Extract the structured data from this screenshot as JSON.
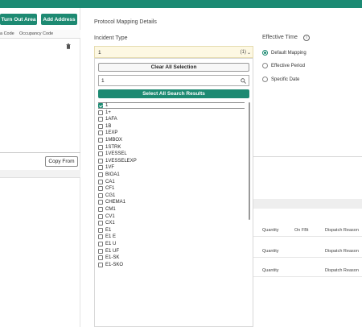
{
  "header": {
    "buttons": {
      "turn_out_area": "Turn Out Area",
      "add_address": "Add Address"
    },
    "left_columns": [
      "a Code",
      "Occupancy Code"
    ],
    "copy_from": "Copy From"
  },
  "protocol_mapping": {
    "title": "Protocol Mapping Details",
    "incident_type_label": "Incident Type",
    "selected_value": "1",
    "selected_count": "(1)",
    "clear_all": "Clear All Selection",
    "search_value": "1",
    "select_all": "Select All Search Results",
    "options": [
      {
        "label": "1",
        "checked": true
      },
      {
        "label": "1+",
        "checked": false
      },
      {
        "label": "1AFA",
        "checked": false
      },
      {
        "label": "1B",
        "checked": false
      },
      {
        "label": "1EXP",
        "checked": false
      },
      {
        "label": "1MBOX",
        "checked": false
      },
      {
        "label": "1STRK",
        "checked": false
      },
      {
        "label": "1VESSEL",
        "checked": false
      },
      {
        "label": "1VESSELEXP",
        "checked": false
      },
      {
        "label": "1VF",
        "checked": false
      },
      {
        "label": "BIOA1",
        "checked": false
      },
      {
        "label": "CA1",
        "checked": false
      },
      {
        "label": "CF1",
        "checked": false
      },
      {
        "label": "CG1",
        "checked": false
      },
      {
        "label": "CHEMA1",
        "checked": false
      },
      {
        "label": "CM1",
        "checked": false
      },
      {
        "label": "CV1",
        "checked": false
      },
      {
        "label": "CX1",
        "checked": false
      },
      {
        "label": "E1",
        "checked": false
      },
      {
        "label": "E1 E",
        "checked": false
      },
      {
        "label": "E1 U",
        "checked": false
      },
      {
        "label": "E1 UF",
        "checked": false
      },
      {
        "label": "E1-SK",
        "checked": false
      },
      {
        "label": "E1-SKO",
        "checked": false
      }
    ]
  },
  "effective_time": {
    "label": "Effective Time",
    "info_glyph": "i",
    "options": [
      {
        "label": "Default Mapping",
        "selected": true
      },
      {
        "label": "Effective Period",
        "selected": false
      },
      {
        "label": "Specific Date",
        "selected": false
      }
    ]
  },
  "table_headers": {
    "quantity": "Quantity",
    "on_fbt": "On FBt",
    "dispatch_reason": "Dispatch Reason"
  },
  "colors": {
    "brand_green": "#1d8a72",
    "topbar": "#1b8a73",
    "select_bg": "#fdf8e3"
  }
}
